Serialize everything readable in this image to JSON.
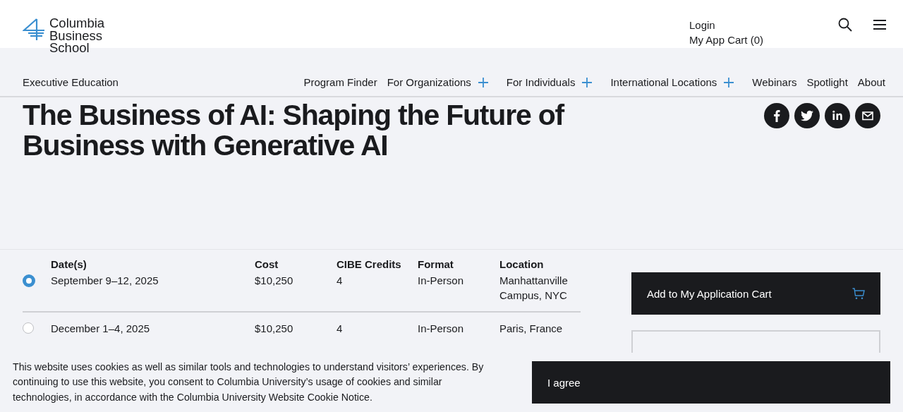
{
  "logo": {
    "lines": [
      "Columbia",
      "Business",
      "School"
    ]
  },
  "header_links": [
    "Login",
    "My App Cart (0)"
  ],
  "section_title": "Executive Education",
  "nav": [
    {
      "label": "Program Finder",
      "has_submenu": false
    },
    {
      "label": "For Organizations",
      "has_submenu": true
    },
    {
      "label": "For Individuals",
      "has_submenu": true
    },
    {
      "label": "International Locations",
      "has_submenu": true
    },
    {
      "label": "Webinars",
      "has_submenu": false
    },
    {
      "label": "Spotlight",
      "has_submenu": false
    },
    {
      "label": "About",
      "has_submenu": false
    }
  ],
  "page_title": "The Business of AI: Shaping the Future of Business with Generative AI",
  "share": [
    {
      "kind": "facebook"
    },
    {
      "kind": "twitter"
    },
    {
      "kind": "linkedin"
    },
    {
      "kind": "email"
    }
  ],
  "table": {
    "columns": [
      "Date(s)",
      "Cost",
      "CIBE Credits",
      "Format",
      "Location"
    ],
    "rows": [
      {
        "selected": true,
        "cells": [
          "September 9–12, 2025",
          "$10,250",
          "4",
          "In-Person",
          "Manhattanville Campus, NYC"
        ]
      },
      {
        "selected": false,
        "cells": [
          "December 1–4, 2025",
          "$10,250",
          "4",
          "In-Person",
          "Paris, France"
        ]
      }
    ]
  },
  "cart_button": "Add to My Application Cart",
  "cookie": {
    "text": "This website uses cookies as well as similar tools and technologies to understand visitors’ experiences. By continuing to use this website, you consent to Columbia University’s usage of cookies and similar technologies, in accordance with the Columbia University Website Cookie Notice.",
    "button": "I agree"
  }
}
